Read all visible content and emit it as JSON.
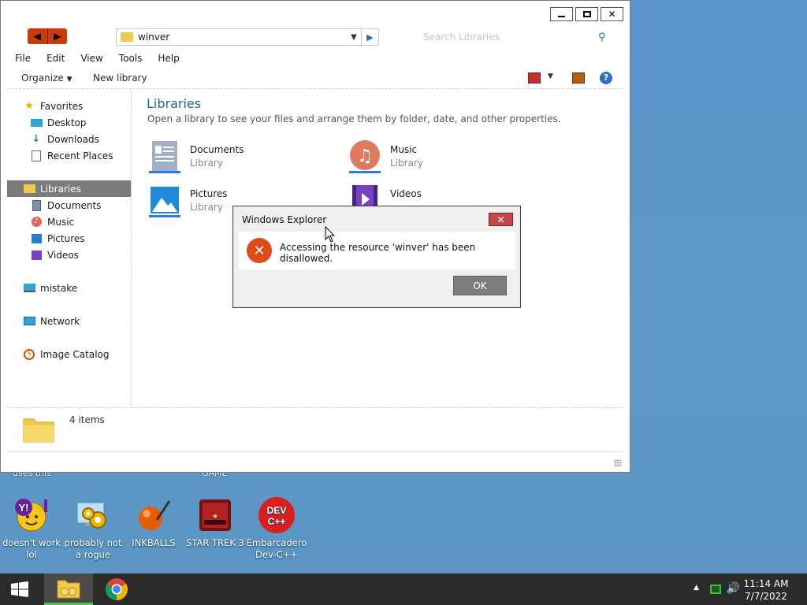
{
  "desktop": {
    "partial_labels": [
      "uses this",
      "GAME"
    ],
    "icons": [
      {
        "label": "doesn't work lol"
      },
      {
        "label": "probably not a rogue"
      },
      {
        "label": "INKBALLS"
      },
      {
        "label": "STAR TREK 3"
      },
      {
        "label": "Embarcadero Dev-C++"
      }
    ]
  },
  "explorer": {
    "address": {
      "value": "winver"
    },
    "search": {
      "placeholder": "Search Libraries"
    },
    "menu": [
      "File",
      "Edit",
      "View",
      "Tools",
      "Help"
    ],
    "commands": {
      "organize": "Organize",
      "new_library": "New library"
    },
    "sidebar": {
      "favorites": "Favorites",
      "desktop": "Desktop",
      "downloads": "Downloads",
      "recent": "Recent Places",
      "libraries": "Libraries",
      "documents": "Documents",
      "music": "Music",
      "pictures": "Pictures",
      "videos": "Videos",
      "mistake": "mistake",
      "network": "Network",
      "image_catalog": "Image Catalog"
    },
    "content": {
      "title": "Libraries",
      "subtitle": "Open a library to see your files and arrange them by folder, date, and other properties.",
      "libraries": [
        {
          "name": "Documents",
          "type": "Library"
        },
        {
          "name": "Music",
          "type": "Library"
        },
        {
          "name": "Pictures",
          "type": "Library"
        },
        {
          "name": "Videos",
          "type": ""
        }
      ]
    },
    "status": {
      "count": "4 items"
    }
  },
  "dialog": {
    "title": "Windows Explorer",
    "message": "Accessing the resource 'winver' has been disallowed.",
    "ok": "OK"
  },
  "taskbar": {
    "time": "11:14 AM",
    "date": "7/7/2022"
  },
  "colors": {
    "desktop": "#5e97c9",
    "taskbar": "#2b2b2b",
    "error": "#df4b16",
    "selection": "#7b7b7b",
    "link_blue": "#1e5f9e"
  }
}
